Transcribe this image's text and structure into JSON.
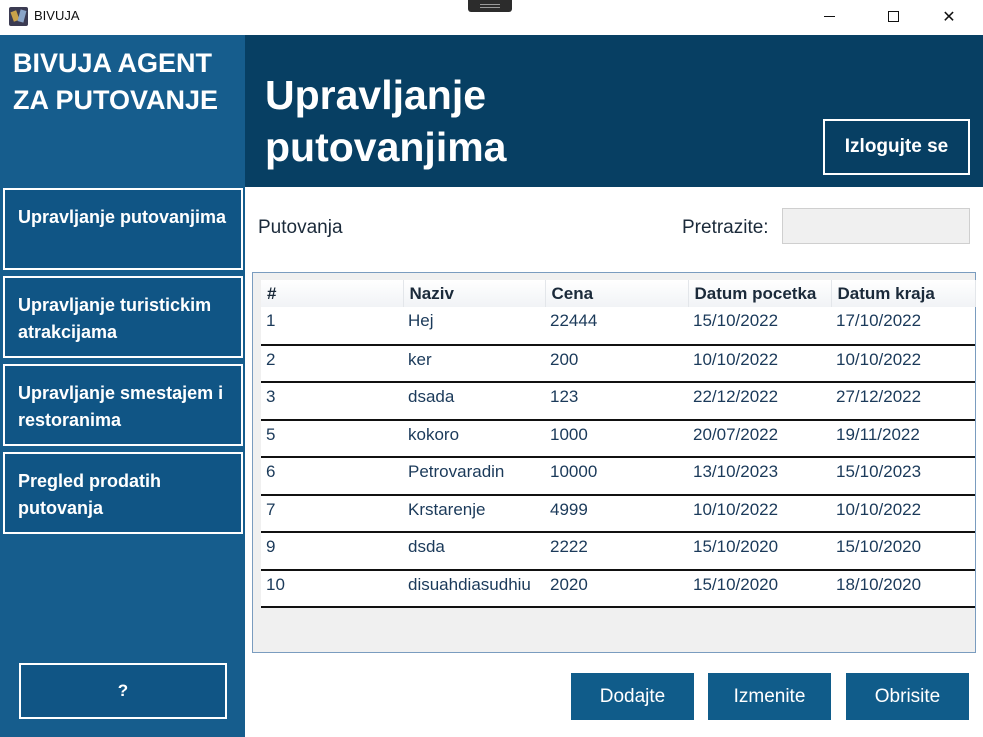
{
  "window": {
    "title": "BIVUJA",
    "minimize": "",
    "maximize": "",
    "close": "✕"
  },
  "sidebar": {
    "brand": "BIVUJA AGENT ZA PUTOVANJE",
    "items": [
      {
        "label": "Upravljanje putovanjima"
      },
      {
        "label": "Upravljanje turistickim atrakcijama"
      },
      {
        "label": "Upravljanje smestajem i restoranima"
      },
      {
        "label": "Pregled prodatih putovanja"
      }
    ],
    "help_label": "?"
  },
  "header": {
    "title": "Upravljanje putovanjima",
    "logout_label": "Izlogujte se"
  },
  "content": {
    "section_label": "Putovanja",
    "search_label": "Pretrazite:",
    "search_value": ""
  },
  "table": {
    "columns": [
      "#",
      "Naziv",
      "Cena",
      "Datum pocetka",
      "Datum kraja"
    ],
    "rows": [
      [
        "1",
        "Hej",
        "22444",
        "15/10/2022",
        "17/10/2022"
      ],
      [
        "2",
        "ker",
        "200",
        "10/10/2022",
        "10/10/2022"
      ],
      [
        "3",
        "dsada",
        "123",
        "22/12/2022",
        "27/12/2022"
      ],
      [
        "5",
        "kokoro",
        "1000",
        "20/07/2022",
        "19/11/2022"
      ],
      [
        "6",
        "Petrovaradin",
        "10000",
        "13/10/2023",
        "15/10/2023"
      ],
      [
        "7",
        "Krstarenje",
        "4999",
        "10/10/2022",
        "10/10/2022"
      ],
      [
        "9",
        "dsda",
        "2222",
        "15/10/2020",
        "15/10/2020"
      ],
      [
        "10",
        "disuahdiasudhiu",
        "2020",
        "15/10/2020",
        "18/10/2020"
      ]
    ]
  },
  "actions": {
    "add_label": "Dodajte",
    "edit_label": "Izmenite",
    "delete_label": "Obrisite"
  },
  "colors": {
    "sidebar": "#165d8d",
    "header": "#073f63",
    "button": "#105c8a"
  }
}
